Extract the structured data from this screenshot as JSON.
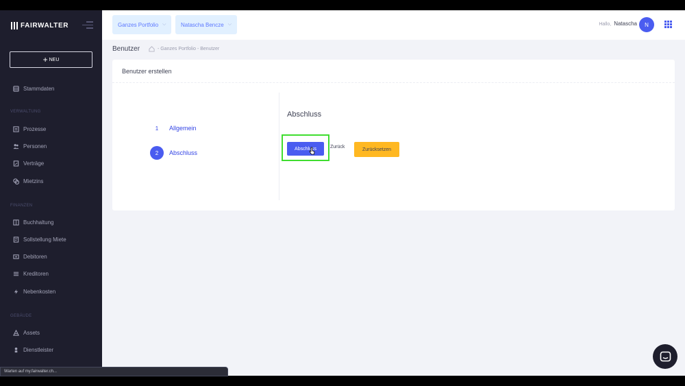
{
  "brand": {
    "logo_text": "FAIRWALTER"
  },
  "sidebar": {
    "new_button_label": "NEU",
    "top_item": {
      "label": "Stammdaten",
      "icon": "database-icon"
    },
    "sections": [
      {
        "label": "VERWALTUNG",
        "items": [
          {
            "label": "Prozesse",
            "icon": "process-icon"
          },
          {
            "label": "Personen",
            "icon": "people-icon"
          },
          {
            "label": "Verträge",
            "icon": "contract-icon"
          },
          {
            "label": "Mietzins",
            "icon": "coins-icon"
          }
        ]
      },
      {
        "label": "FINANZEN",
        "items": [
          {
            "label": "Buchhaltung",
            "icon": "ledger-icon"
          },
          {
            "label": "Sollstellung Miete",
            "icon": "invoice-icon"
          },
          {
            "label": "Debitoren",
            "icon": "debtor-icon"
          },
          {
            "label": "Kreditoren",
            "icon": "creditor-icon"
          },
          {
            "label": "Nebenkosten",
            "icon": "cost-icon"
          }
        ]
      },
      {
        "label": "GEBÄUDE",
        "items": [
          {
            "label": "Assets",
            "icon": "building-icon"
          },
          {
            "label": "Dienstleister",
            "icon": "worker-icon"
          }
        ]
      }
    ]
  },
  "header": {
    "portfolio_dropdown": "Ganzes Portfolio",
    "user_dropdown": "Natascha Bencze",
    "greeting": "Hallo,",
    "user_first_name": "Natascha",
    "avatar_initial": "N"
  },
  "subheader": {
    "title": "Benutzer",
    "breadcrumb": "Ganzes Portfolio - Benutzer"
  },
  "card": {
    "title": "Benutzer erstellen",
    "steps": [
      {
        "number": "1",
        "label": "Allgemein",
        "active": false
      },
      {
        "number": "2",
        "label": "Abschluss",
        "active": true
      }
    ],
    "section_title": "Abschluss",
    "buttons": {
      "submit": "Abschluss",
      "back": "Zurück",
      "reset": "Zurücksetzen"
    }
  },
  "statusbar": {
    "text": "Warten auf my.fairwalter.ch..."
  },
  "colors": {
    "sidebar_bg": "#1e1e2d",
    "primary": "#4a5cf0",
    "warning": "#ffb822",
    "highlight": "#3fdd2f"
  }
}
